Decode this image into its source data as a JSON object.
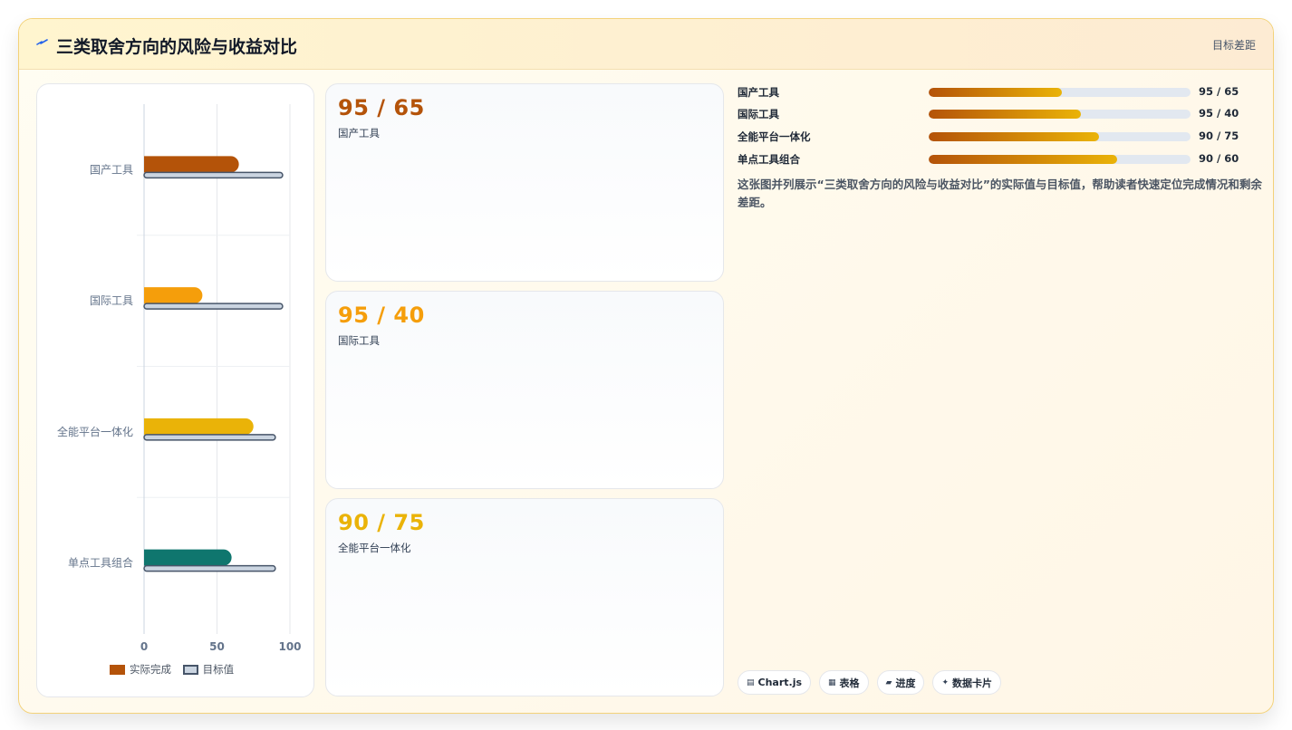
{
  "header": {
    "icon": "lightning-icon",
    "title": "三类取舍方向的风险与收益对比",
    "badge": "目标差距"
  },
  "colors": {
    "series": [
      "#b45309",
      "#f59e0b",
      "#eab308",
      "#0f766e"
    ],
    "target_fill": "#cbd5e1",
    "target_stroke": "#475569"
  },
  "chart_data": {
    "type": "bar",
    "orientation": "horizontal",
    "categories": [
      "国产工具",
      "国际工具",
      "全能平台一体化",
      "单点工具组合"
    ],
    "series": [
      {
        "name": "实际完成",
        "values": [
          65,
          40,
          75,
          60
        ]
      },
      {
        "name": "目标值",
        "values": [
          95,
          95,
          90,
          90
        ]
      }
    ],
    "x_ticks": [
      "0",
      "50",
      "100"
    ],
    "xlim": [
      0,
      100
    ],
    "grid": true,
    "legend_position": "bottom"
  },
  "stat_cards": [
    {
      "value": "95 / 65",
      "label": "国产工具",
      "color": "#b45309"
    },
    {
      "value": "95 / 40",
      "label": "国际工具",
      "color": "#f59e0b"
    },
    {
      "value": "90 / 75",
      "label": "全能平台一体化",
      "color": "#eab308"
    }
  ],
  "progress": [
    {
      "label": "国产工具",
      "value": "95 / 65",
      "fraction": 0.51
    },
    {
      "label": "国际工具",
      "value": "95 / 40",
      "fraction": 0.58
    },
    {
      "label": "全能平台一体化",
      "value": "90 / 75",
      "fraction": 0.65
    },
    {
      "label": "单点工具组合",
      "value": "90 / 60",
      "fraction": 0.72
    }
  ],
  "description": "这张图并列展示“三类取舍方向的风险与收益对比”的实际值与目标值，帮助读者快速定位完成情况和剩余差距。",
  "tags": [
    {
      "icon": "chart-icon",
      "glyph": "▤",
      "label": "Chart.js"
    },
    {
      "icon": "table-icon",
      "glyph": "▦",
      "label": "表格"
    },
    {
      "icon": "progress-icon",
      "glyph": "▰",
      "label": "进度"
    },
    {
      "icon": "sparkle-icon",
      "glyph": "✦",
      "label": "数据卡片"
    }
  ]
}
